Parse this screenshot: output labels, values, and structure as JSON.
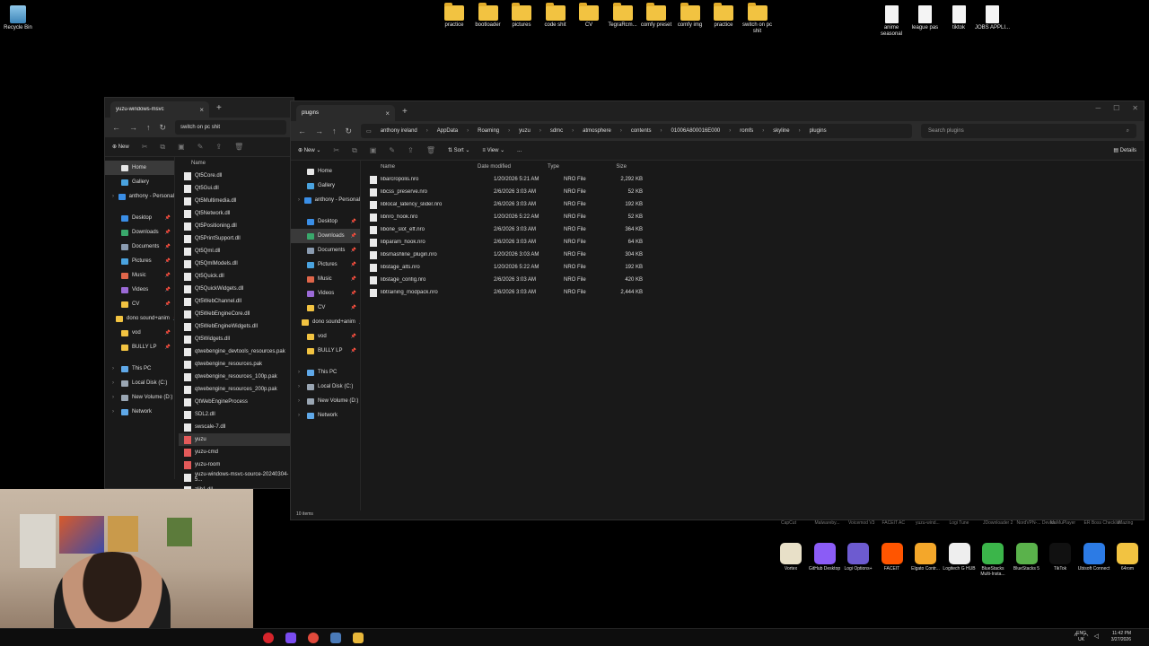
{
  "desktop": {
    "left_icons": [
      {
        "label": "Recycle Bin",
        "kind": "bin"
      }
    ],
    "top_icons": [
      {
        "label": "practice",
        "kind": "folder"
      },
      {
        "label": "bootloader",
        "kind": "folder"
      },
      {
        "label": "pictures",
        "kind": "folder"
      },
      {
        "label": "code shit",
        "kind": "folder"
      },
      {
        "label": "CV",
        "kind": "folder"
      },
      {
        "label": "TegraRcm...",
        "kind": "folder"
      },
      {
        "label": "comfy preset",
        "kind": "folder"
      },
      {
        "label": "comfy img",
        "kind": "folder"
      },
      {
        "label": "practice",
        "kind": "folder"
      },
      {
        "label": "switch on pc shit",
        "kind": "folder"
      }
    ],
    "right_icons": [
      {
        "label": "anime seasonal",
        "kind": "doc"
      },
      {
        "label": "league pas",
        "kind": "doc"
      },
      {
        "label": "tiktok",
        "kind": "doc"
      },
      {
        "label": "JOBS APPLI...",
        "kind": "doc"
      }
    ]
  },
  "back_window": {
    "tab_title": "yuzu-windows-msvc",
    "address": "switch on pc shit",
    "new_label": "New",
    "col_name": "Name",
    "nav": [
      {
        "label": "Home",
        "icon": "home-icon",
        "selected": true
      },
      {
        "label": "Gallery",
        "icon": "gallery-icon"
      },
      {
        "label": "anthony - Personal",
        "icon": "cloud-icon"
      },
      {
        "label": "Desktop",
        "icon": "desktop-icon"
      },
      {
        "label": "Downloads",
        "icon": "download-icon"
      },
      {
        "label": "Documents",
        "icon": "documents-icon"
      },
      {
        "label": "Pictures",
        "icon": "pictures-icon"
      },
      {
        "label": "Music",
        "icon": "music-icon"
      },
      {
        "label": "Videos",
        "icon": "videos-icon"
      },
      {
        "label": "CV",
        "icon": "folder-icon"
      },
      {
        "label": "dono sound+anim",
        "icon": "folder-icon"
      },
      {
        "label": "vod",
        "icon": "folder-icon"
      },
      {
        "label": "BULLY LP",
        "icon": "folder-icon"
      },
      {
        "label": "This PC",
        "icon": "pc-icon"
      },
      {
        "label": "Local Disk (C:)",
        "icon": "drive-icon"
      },
      {
        "label": "New Volume (D:)",
        "icon": "drive-icon"
      },
      {
        "label": "Network",
        "icon": "network-icon"
      }
    ],
    "files": [
      "Qt5Core.dll",
      "Qt5Gui.dll",
      "Qt5Multimedia.dll",
      "Qt5Network.dll",
      "Qt5Positioning.dll",
      "Qt5PrintSupport.dll",
      "Qt5Qml.dll",
      "Qt5QmlModels.dll",
      "Qt5Quick.dll",
      "Qt5QuickWidgets.dll",
      "Qt5WebChannel.dll",
      "Qt5WebEngineCore.dll",
      "Qt5WebEngineWidgets.dll",
      "Qt5Widgets.dll",
      "qtwebengine_devtools_resources.pak",
      "qtwebengine_resources.pak",
      "qtwebengine_resources_100p.pak",
      "qtwebengine_resources_200p.pak",
      "QtWebEngineProcess",
      "SDL2.dll",
      "swscale-7.dll",
      "yuzu",
      "yuzu-cmd",
      "yuzu-room",
      "yuzu-windows-msvc-source-20240304-5...",
      "zlib1.dll"
    ]
  },
  "front_window": {
    "tab_title": "plugins",
    "breadcrumbs": [
      "anthony ireland",
      "AppData",
      "Roaming",
      "yuzu",
      "sdmc",
      "atmosphere",
      "contents",
      "01006A800016E000",
      "romfs",
      "skyline",
      "plugins"
    ],
    "search_placeholder": "Search plugins",
    "toolbar": {
      "new": "New",
      "sort": "Sort",
      "view": "View",
      "details": "Details",
      "more": "..."
    },
    "columns": {
      "name": "Name",
      "date": "Date modified",
      "type": "Type",
      "size": "Size"
    },
    "nav": [
      {
        "label": "Home",
        "icon": "home-icon"
      },
      {
        "label": "Gallery",
        "icon": "gallery-icon"
      },
      {
        "label": "anthony - Personal",
        "icon": "cloud-icon"
      },
      {
        "label": "Desktop",
        "icon": "desktop-icon"
      },
      {
        "label": "Downloads",
        "icon": "download-icon",
        "selected": true
      },
      {
        "label": "Documents",
        "icon": "documents-icon"
      },
      {
        "label": "Pictures",
        "icon": "pictures-icon"
      },
      {
        "label": "Music",
        "icon": "music-icon"
      },
      {
        "label": "Videos",
        "icon": "videos-icon"
      },
      {
        "label": "CV",
        "icon": "folder-icon"
      },
      {
        "label": "dono sound+anim",
        "icon": "folder-icon"
      },
      {
        "label": "vod",
        "icon": "folder-icon"
      },
      {
        "label": "BULLY LP",
        "icon": "folder-icon"
      },
      {
        "label": "This PC",
        "icon": "pc-icon"
      },
      {
        "label": "Local Disk (C:)",
        "icon": "drive-icon"
      },
      {
        "label": "New Volume (D:)",
        "icon": "drive-icon"
      },
      {
        "label": "Network",
        "icon": "network-icon"
      }
    ],
    "files": [
      {
        "name": "libarcropolis.nro",
        "date": "1/20/2026 5:21 AM",
        "type": "NRO File",
        "size": "2,292 KB"
      },
      {
        "name": "libcss_preserve.nro",
        "date": "2/6/2026 3:03 AM",
        "type": "NRO File",
        "size": "52 KB"
      },
      {
        "name": "liblocal_latency_slider.nro",
        "date": "2/6/2026 3:03 AM",
        "type": "NRO File",
        "size": "192 KB"
      },
      {
        "name": "libnro_hook.nro",
        "date": "1/20/2026 5:22 AM",
        "type": "NRO File",
        "size": "52 KB"
      },
      {
        "name": "libone_slot_eff.nro",
        "date": "2/6/2026 3:03 AM",
        "type": "NRO File",
        "size": "364 KB"
      },
      {
        "name": "libparam_hook.nro",
        "date": "2/6/2026 3:03 AM",
        "type": "NRO File",
        "size": "64 KB"
      },
      {
        "name": "libsmashline_plugin.nro",
        "date": "1/20/2026 3:03 AM",
        "type": "NRO File",
        "size": "304 KB"
      },
      {
        "name": "libstage_alts.nro",
        "date": "1/20/2026 5:22 AM",
        "type": "NRO File",
        "size": "192 KB"
      },
      {
        "name": "libstage_config.nro",
        "date": "2/6/2026 3:03 AM",
        "type": "NRO File",
        "size": "420 KB"
      },
      {
        "name": "libtraining_modpack.nro",
        "date": "2/6/2026 3:03 AM",
        "type": "NRO File",
        "size": "2,444 KB"
      }
    ],
    "status": "10 items"
  },
  "tray_apps": [
    {
      "label": "Vortex",
      "color": "#e8e0c8"
    },
    {
      "label": "GitHub Desktop",
      "color": "#8b5cf6"
    },
    {
      "label": "Logi Options+",
      "color": "#6d5bd0"
    },
    {
      "label": "FACEIT",
      "color": "#ff5500"
    },
    {
      "label": "Elgato Contr...",
      "color": "#f4a72a"
    },
    {
      "label": "Logitech G HUB",
      "color": "#eeeeee"
    },
    {
      "label": "BlueStacks Multi-Insta...",
      "color": "#3bb54a"
    },
    {
      "label": "BlueStacks 5",
      "color": "#5ab24b"
    },
    {
      "label": "TikTok",
      "color": "#111111"
    },
    {
      "label": "Ubisoft Connect",
      "color": "#2c7be5"
    },
    {
      "label": "64rom",
      "color": "#f2c341"
    }
  ],
  "ghost_labels": [
    "CapCut",
    "Malwareby...",
    "Voicemod V3",
    "FACEIT AC",
    "yuzu-wind...",
    "Logi Tune",
    "JDownloader 2",
    "NordVPN-... Device",
    "MuMuPlayer",
    "ER Boss Checklist",
    "iMazing"
  ],
  "taskbar": {
    "lang": "ENG\nUK",
    "time": "11:42 PM",
    "date": "3/27/2026"
  }
}
